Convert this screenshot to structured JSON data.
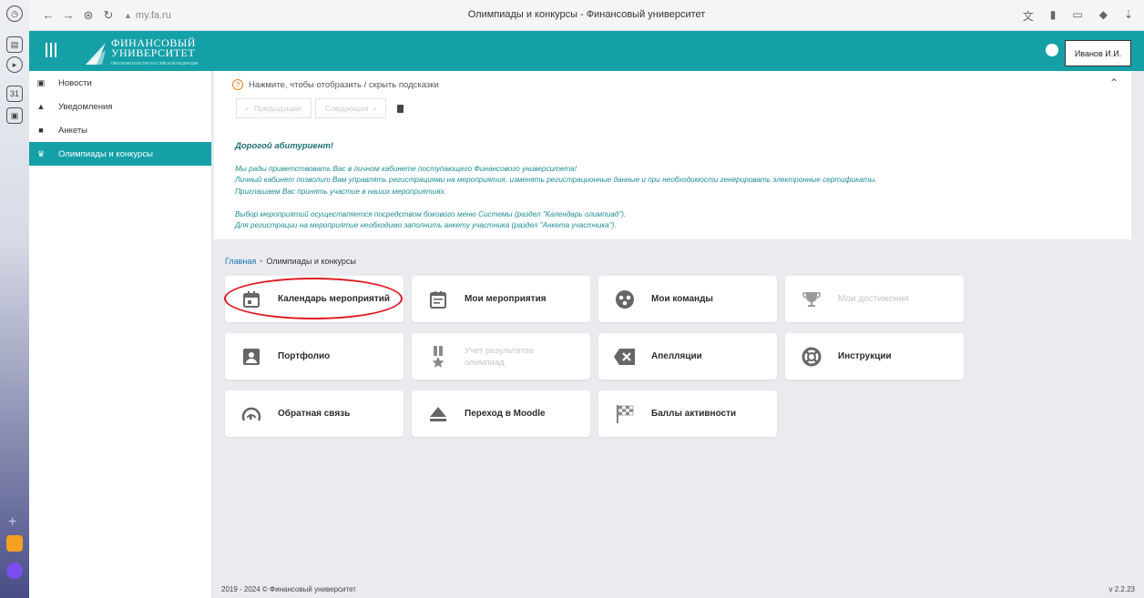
{
  "browser": {
    "url": "my.fa.ru",
    "page_title": "Олимпиады и конкурсы - Финансовый университет"
  },
  "header": {
    "logo_line1": "ФИНАНСОВЫЙ",
    "logo_line2": "УНИВЕРСИТЕТ",
    "logo_sub": "ПРИ ПРАВИТЕЛЬСТВЕ РОССИЙСКОЙ ФЕДЕРАЦИИ",
    "user_name": "Иванов И.И.",
    "accent": "#15a0a8"
  },
  "sidebar": {
    "items": [
      {
        "label": "Новости",
        "icon": "newspaper-icon"
      },
      {
        "label": "Уведомления",
        "icon": "bell-icon"
      },
      {
        "label": "Анкеты",
        "icon": "form-icon"
      },
      {
        "label": "Олимпиады и конкурсы",
        "icon": "trophy-icon",
        "active": true
      }
    ]
  },
  "hints": {
    "toggle_label": "Нажмите, чтобы отобразить / скрыть подсказки",
    "prev_label": "Предыдущая",
    "next_label": "Следующая",
    "greeting": "Дорогой абитуриент!",
    "lines": [
      "Мы рады приветствовать Вас в личном кабинете поступающего Финансового университета!",
      "Личный кабинет позволит Вам управлять регистрациями на мероприятия, изменять регистрационные данные и при необходимости генерировать электронные сертификаты.",
      "Приглашаем Вас принять участие в наших мероприятиях.",
      "",
      "Выбор мероприятий осуществляется посредством бокового меню Системы (раздел \"Календарь олимпиад\").",
      "Для регистрации на мероприятие необходимо заполнить анкету участника (раздел \"Анкета участника\")."
    ]
  },
  "breadcrumb": {
    "home": "Главная",
    "current": "Олимпиады и конкурсы"
  },
  "cards": {
    "calendar": "Календарь мероприятий",
    "my_events": "Мои мероприятия",
    "my_teams": "Мои команды",
    "achievements": "Мои достижения",
    "portfolio": "Портфолио",
    "results_line1": "Учет результатов",
    "results_line2": "олимпиад",
    "appeals": "Апелляции",
    "instructions": "Инструкции",
    "feedback": "Обратная связь",
    "moodle": "Переход в Moodle",
    "activity": "Баллы активности"
  },
  "footer": {
    "copyright": "2019 - 2024 © Финансовый университет",
    "version": "v 2.2.23"
  }
}
